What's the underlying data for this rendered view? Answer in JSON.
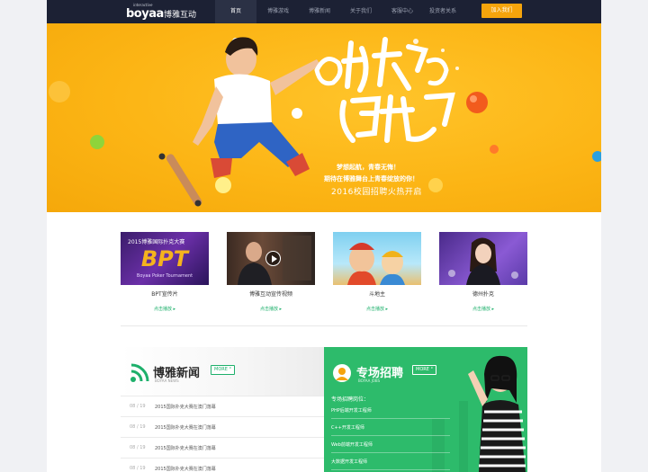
{
  "nav": {
    "logo_small": "interactive",
    "logo_word": "boyaa",
    "logo_cn": "博雅互动",
    "items": [
      {
        "label": "首页"
      },
      {
        "label": "博雅游戏"
      },
      {
        "label": "博雅新闻"
      },
      {
        "label": "关于我们"
      },
      {
        "label": "客服中心"
      },
      {
        "label": "投资者关系"
      }
    ],
    "join_label": "加入我们"
  },
  "banner": {
    "title": "旅程 逆青春",
    "slogan": "梦想起航，青春无悔！",
    "sub": "期待在博雅舞台上青春绽放的你！",
    "hire": "2016校园招聘火热开启"
  },
  "videos": [
    {
      "title": "BPT宣传片",
      "link": "点击播放 ▸",
      "thumb_year": "2015博雅国际扑克大赛",
      "thumb_big": "BPT",
      "thumb_sub": "Boyaa Poker Tournament"
    },
    {
      "title": "博雅互动宣传视频",
      "link": "点击播放 ▸"
    },
    {
      "title": "斗地主",
      "link": "点击播放 ▸"
    },
    {
      "title": "德州扑克",
      "link": "点击播放 ▸"
    }
  ],
  "news": {
    "title": "博雅新闻",
    "en": "BOYAA NEWS",
    "more": "MORE °",
    "items": [
      {
        "date": "08 / 19",
        "text": "2015国际扑克大赛在澳门落幕"
      },
      {
        "date": "08 / 19",
        "text": "2015国际扑克大赛在澳门落幕"
      },
      {
        "date": "08 / 19",
        "text": "2015国际扑克大赛在澳门落幕"
      },
      {
        "date": "08 / 19",
        "text": "2015国际扑克大赛在澳门落幕"
      }
    ]
  },
  "jobs": {
    "title": "专场招聘",
    "en": "BOYAA JOBS",
    "more": "MORE °",
    "sub": "专场招聘岗位：",
    "items": [
      {
        "text": "PHP后端开发工程师"
      },
      {
        "text": "C++开发工程师"
      },
      {
        "text": "Web前端开发工程师"
      },
      {
        "text": "大数据开发工程师"
      }
    ]
  },
  "colors": {
    "nav_bg": "#1c2134",
    "accent": "#f5a40c",
    "banner": "#fcb515",
    "green": "#2dbb6b"
  }
}
